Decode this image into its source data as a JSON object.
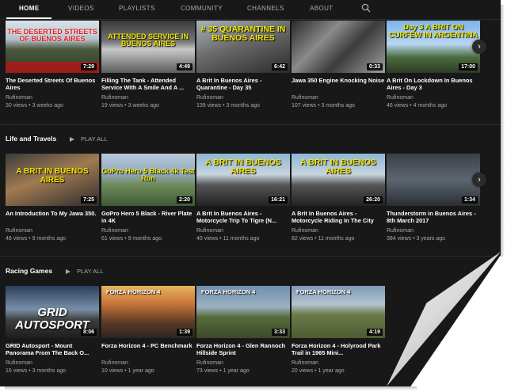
{
  "nav": {
    "tabs": [
      "HOME",
      "VIDEOS",
      "PLAYLISTS",
      "COMMUNITY",
      "CHANNELS",
      "ABOUT"
    ],
    "active": "HOME",
    "search_icon": "search-icon"
  },
  "play_all_label": "PLAY ALL",
  "shelves": [
    {
      "title": "",
      "videos": [
        {
          "overlay": "THE DESERTED STREETS OF BUENOS AIRES",
          "duration": "7:29",
          "title": "The Deserted Streets Of Buenos Aires",
          "channel": "Rufinoman",
          "meta": "30 views • 3 weeks ago"
        },
        {
          "overlay": "ATTENDED SERVICE IN BUENOS AIRES",
          "duration": "4:49",
          "title": "Filling The Tank - Attended Service With A Smile And A ...",
          "channel": "Rufinoman",
          "meta": "19 views • 3 weeks ago"
        },
        {
          "overlay": "# 35 QUARANTINE IN BUENOS AIRES",
          "duration": "6:42",
          "title": "A Brit In Buenos Aires - Quarantine - Day 35",
          "channel": "Rufinoman",
          "meta": "139 views • 3 months ago"
        },
        {
          "overlay": "",
          "duration": "0:33",
          "title": "Jawa 350 Engine Knocking Noise",
          "channel": "Rufinoman",
          "meta": "107 views • 3 months ago"
        },
        {
          "overlay": "Day 3 A BRIT ON CURFEW IN ARGENTINA",
          "duration": "17:00",
          "title": "A Brit On Lockdown In Buenos Aires - Day 3",
          "channel": "Rufinoman",
          "meta": "46 views • 4 months ago"
        }
      ]
    },
    {
      "title": "Life and Travels",
      "videos": [
        {
          "overlay": "A BRIT IN BUENOS AIRES",
          "duration": "7:25",
          "title": "An Introduction To My Jawa 350.",
          "channel": "Rufinoman",
          "meta": "48 views • 9 months ago"
        },
        {
          "overlay": "GoPro Hero 5 Black 4k Test Run",
          "duration": "2:20",
          "title": "GoPro Hero 5 Black - River Plate in 4K",
          "channel": "Rufinoman",
          "meta": "61 views • 9 months ago"
        },
        {
          "overlay": "A BRIT IN BUENOS AIRES",
          "duration": "16:21",
          "title": "A Brit In Buenos Aires - Motorcycle Trip To Tigre (N...",
          "channel": "Rufinoman",
          "meta": "40 views • 11 months ago"
        },
        {
          "overlay": "A BRIT IN BUENOS AIRES",
          "duration": "26:20",
          "title": "A Brit In Buenos Aires - Motorcycle Riding In The City",
          "channel": "Rufinoman",
          "meta": "82 views • 11 months ago"
        },
        {
          "overlay": "",
          "duration": "1:34",
          "title": "Thunderstorm in Buenos Aires - 8th March 2017",
          "channel": "Rufinoman",
          "meta": "384 views • 3 years ago"
        }
      ]
    },
    {
      "title": "Racing Games",
      "videos": [
        {
          "overlay": "GRID AUTOSPORT",
          "duration": "8:06",
          "title": "GRID Autosport - Mount Panorama From The Back O...",
          "channel": "Rufinoman",
          "meta": "16 views • 3 months ago"
        },
        {
          "overlay": "FORZA HORIZON 4",
          "duration": "1:39",
          "title": "Forza Horizon 4 - PC Benchmark",
          "channel": "Rufinoman",
          "meta": "10 views • 1 year ago"
        },
        {
          "overlay": "FORZA HORIZON 4",
          "duration": "3:33",
          "title": "Forza Horizon 4 - Glen Rannoch Hillside Sprint",
          "channel": "Rufinoman",
          "meta": "73 views • 1 year ago"
        },
        {
          "overlay": "FORZA HORIZON 4",
          "duration": "4:19",
          "title": "Forza Horizon 4 - Holyrood Park Trail in 1965 Mini...",
          "channel": "Rufinoman",
          "meta": "20 views • 1 year ago"
        }
      ]
    }
  ]
}
